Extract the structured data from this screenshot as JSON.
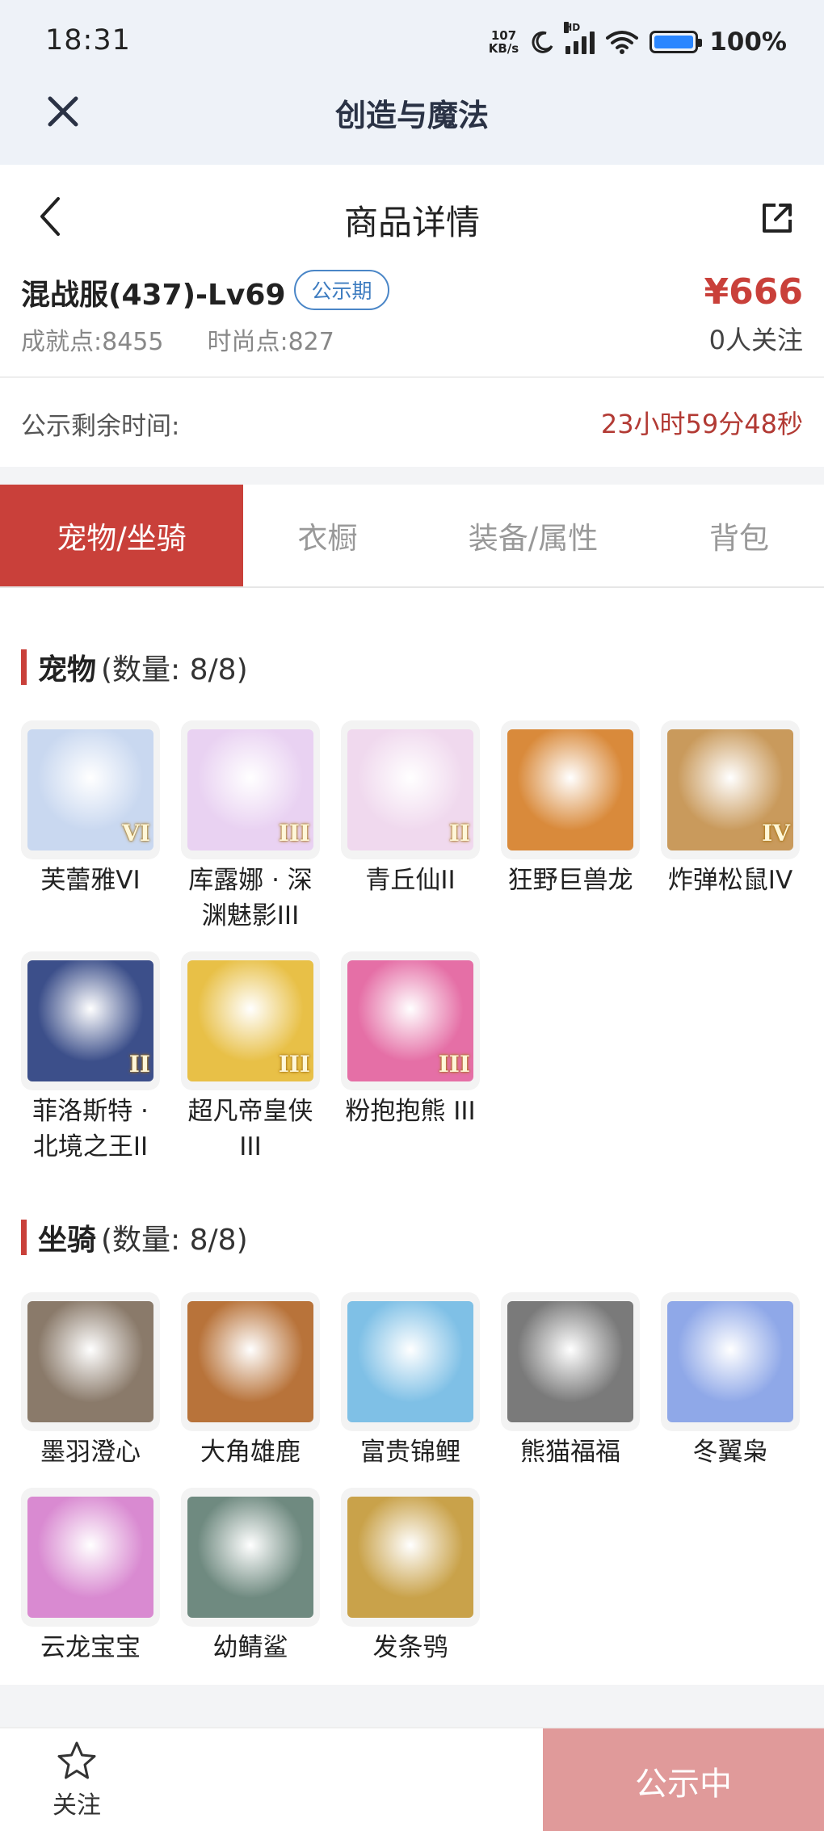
{
  "status_bar": {
    "time": "18:31",
    "net_speed_value": "107",
    "net_speed_unit": "KB/s",
    "hd_label": "HD",
    "battery_pct": "100%",
    "icons": [
      "moon-icon",
      "signal-icon",
      "wifi-icon",
      "battery-icon"
    ]
  },
  "app_bar": {
    "title": "创造与魔法",
    "close_icon": "close-icon"
  },
  "detail_nav": {
    "title": "商品详情",
    "back_icon": "chevron-left-icon",
    "share_icon": "share-icon"
  },
  "summary": {
    "server_name": "混战服(437)-Lv69",
    "period_badge": "公示期",
    "price": "¥666",
    "achievement": "成就点:8455",
    "fashion": "时尚点:827",
    "follow_count": "0人关注"
  },
  "countdown": {
    "label": "公示剩余时间:",
    "value": "23小时59分48秒"
  },
  "tabs": [
    {
      "label": "宠物/坐骑",
      "active": true
    },
    {
      "label": "衣橱",
      "active": false
    },
    {
      "label": "装备/属性",
      "active": false
    },
    {
      "label": "背包",
      "active": false
    }
  ],
  "pets": {
    "title": "宠物",
    "count": "(数量: 8/8)",
    "items": [
      {
        "name": "芙蕾雅VI",
        "tier": "VI",
        "color": "#c9d8f0"
      },
      {
        "name": "库露娜 · 深渊魅影III",
        "tier": "III",
        "color": "#e9d2f2"
      },
      {
        "name": "青丘仙II",
        "tier": "II",
        "color": "#f0d9ee"
      },
      {
        "name": "狂野巨兽龙",
        "tier": "",
        "color": "#d98a3b"
      },
      {
        "name": "炸弹松鼠IV",
        "tier": "IV",
        "color": "#c99a5c"
      },
      {
        "name": "菲洛斯特 · 北境之王II",
        "tier": "II",
        "color": "#3c4f8a"
      },
      {
        "name": "超凡帝皇侠III",
        "tier": "III",
        "color": "#e8c047"
      },
      {
        "name": "粉抱抱熊 III",
        "tier": "III",
        "color": "#e56fa6"
      }
    ]
  },
  "mounts": {
    "title": "坐骑",
    "count": "(数量: 8/8)",
    "items": [
      {
        "name": "墨羽澄心",
        "color": "#8a7a6a"
      },
      {
        "name": "大角雄鹿",
        "color": "#b8733a"
      },
      {
        "name": "富贵锦鲤",
        "color": "#7fc0e6"
      },
      {
        "name": "熊猫福福",
        "color": "#7a7a7a"
      },
      {
        "name": "冬翼枭",
        "color": "#8fa8e8"
      },
      {
        "name": "云龙宝宝",
        "color": "#d98ad1"
      },
      {
        "name": "幼鲭鲨",
        "color": "#6f8a80"
      },
      {
        "name": "发条鸮",
        "color": "#c9a24a"
      }
    ]
  },
  "bottom_bar": {
    "fav_label": "关注",
    "fav_icon": "star-icon",
    "status_button": "公示中"
  }
}
